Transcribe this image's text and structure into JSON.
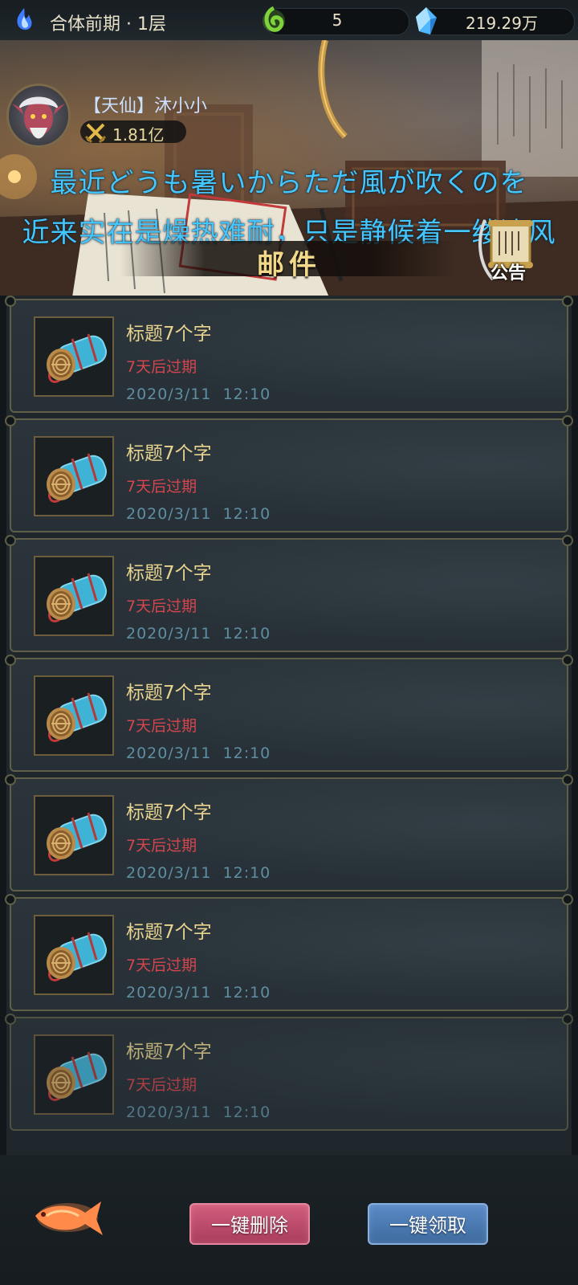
{
  "topbar": {
    "realm_label": "合体前期 · 1层",
    "jade_value": "5",
    "crystal_value": "219.29万"
  },
  "player": {
    "name": "【天仙】沐小小",
    "power": "1.81亿"
  },
  "subtitles": {
    "japanese": "最近どうも暑いからただ風が吹くのを",
    "chinese": "近来实在是燥热难耐，只是静候着一缕清风"
  },
  "panel": {
    "title": "邮件",
    "notice_label": "公告"
  },
  "mails": [
    {
      "title": "标题7个字",
      "expire": "7天后过期",
      "date": "2020/3/11",
      "time": "12:10"
    },
    {
      "title": "标题7个字",
      "expire": "7天后过期",
      "date": "2020/3/11",
      "time": "12:10"
    },
    {
      "title": "标题7个字",
      "expire": "7天后过期",
      "date": "2020/3/11",
      "time": "12:10"
    },
    {
      "title": "标题7个字",
      "expire": "7天后过期",
      "date": "2020/3/11",
      "time": "12:10"
    },
    {
      "title": "标题7个字",
      "expire": "7天后过期",
      "date": "2020/3/11",
      "time": "12:10"
    },
    {
      "title": "标题7个字",
      "expire": "7天后过期",
      "date": "2020/3/11",
      "time": "12:10"
    },
    {
      "title": "标题7个字",
      "expire": "7天后过期",
      "date": "2020/3/11",
      "time": "12:10"
    }
  ],
  "buttons": {
    "delete_all": "一键删除",
    "claim_all": "一键领取"
  },
  "icons": {
    "realm": "blue-flame-icon",
    "jade": "green-jade-icon",
    "crystal": "blue-crystal-icon",
    "power": "crossed-swords-icon",
    "mail_item": "scroll-bundle-icon",
    "notice": "notice-scroll-icon",
    "fish": "golden-koi-icon"
  },
  "colors": {
    "mail_title": "#e9d48f",
    "expire_red": "#d6454e",
    "date_blue": "#5f8ea3",
    "subtitle_blue": "#44c6ff",
    "delete_pink": "#c24e6e",
    "claim_blue": "#4f7bb4"
  }
}
